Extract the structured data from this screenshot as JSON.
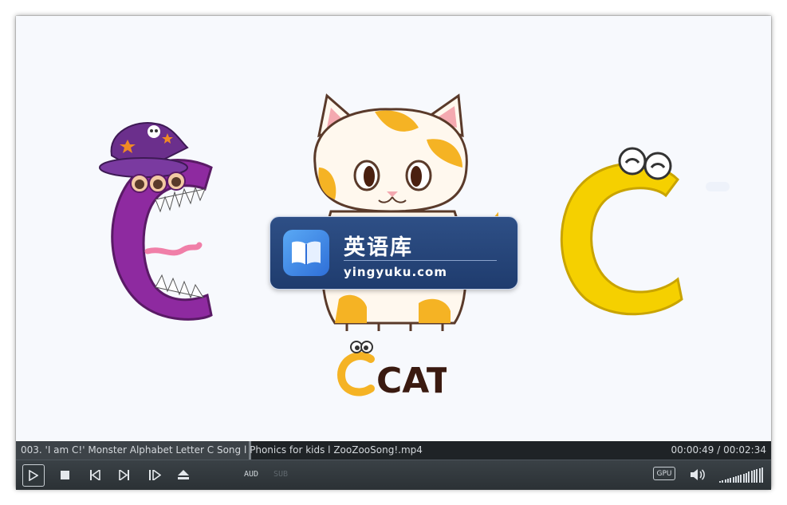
{
  "player": {
    "file_name": "003. 'I am C!' Monster Alphabet Letter C Song l Phonics for kids l ZooZooSong!.mp4",
    "time_display": "00:00:49 / 00:02:34",
    "progress_fraction": 0.31,
    "audio_label": "AUD",
    "subtitle_label": "SUB",
    "gpu_label": "GPU",
    "volume_fraction": 1.0
  },
  "watermark": {
    "title": "英语库",
    "url": "yingyuku.com"
  },
  "video": {
    "cat_word": "CAT"
  },
  "icons": {
    "play": "play-icon",
    "stop": "stop-icon",
    "prev": "previous-icon",
    "next": "next-icon",
    "frame_step": "frame-step-icon",
    "eject": "eject-icon",
    "volume": "speaker-icon",
    "book": "book-icon"
  },
  "colors": {
    "controls_bg": "#2f3539",
    "infobar_bg": "#1f2326",
    "video_bg": "#f7f9fd",
    "watermark_bg": "#25447a",
    "monster_purple": "#8e2aa0",
    "letter_yellow": "#f5d000"
  }
}
